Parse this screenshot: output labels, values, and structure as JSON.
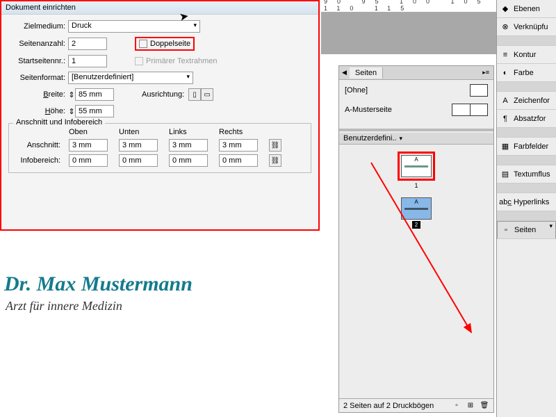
{
  "dialog": {
    "title": "Dokument einrichten",
    "zielmedium_lbl": "Zielmedium:",
    "zielmedium_val": "Druck",
    "seitenanzahl_lbl": "Seitenanzahl:",
    "seitenanzahl_val": "2",
    "doppelseite_lbl": "Doppelseite",
    "startseite_lbl": "Startseitennr.:",
    "startseite_val": "1",
    "textrahmen_lbl": "Primärer Textrahmen",
    "seitenformat_lbl": "Seitenformat:",
    "seitenformat_val": "[Benutzerdefiniert]",
    "breite_lbl": "Breite:",
    "breite_val": "85 mm",
    "hoehe_lbl": "Höhe:",
    "hoehe_val": "55 mm",
    "ausrichtung_lbl": "Ausrichtung:",
    "group_title": "Anschnitt und Infobereich",
    "col_oben": "Oben",
    "col_unten": "Unten",
    "col_links": "Links",
    "col_rechts": "Rechts",
    "anschnitt_lbl": "Anschnitt:",
    "anschnitt_vals": [
      "3 mm",
      "3 mm",
      "3 mm",
      "3 mm"
    ],
    "info_lbl": "Infobereich:",
    "info_vals": [
      "0 mm",
      "0 mm",
      "0 mm",
      "0 mm"
    ]
  },
  "ruler_marks": "90 95 100 105 110 115",
  "right_panel": [
    {
      "icon": "◆",
      "label": "Ebenen"
    },
    {
      "icon": "⊗",
      "label": "Verknüpfu"
    },
    {
      "space": true
    },
    {
      "icon": "≡",
      "label": "Kontur"
    },
    {
      "icon": "◐",
      "label": "Farbe"
    },
    {
      "space": true
    },
    {
      "icon": "A",
      "label": "Zeichenfor"
    },
    {
      "icon": "¶",
      "label": "Absatzfor"
    },
    {
      "space": true
    },
    {
      "icon": "▦",
      "label": "Farbfelder"
    },
    {
      "space": true
    },
    {
      "icon": "▤",
      "label": "Textumflus"
    },
    {
      "space": true
    },
    {
      "icon": "abc̲",
      "label": "Hyperlinks"
    },
    {
      "space": true
    },
    {
      "icon": "▫",
      "label": "Seiten",
      "sel": true
    }
  ],
  "seiten_panel": {
    "tab": "Seiten",
    "ohne": "[Ohne]",
    "muster": "A-Musterseite",
    "dropdown": "Benutzerdefini..",
    "page_letter": "A",
    "page2_num": "2",
    "footer": "2 Seiten auf 2 Druckbögen"
  },
  "document": {
    "name": "Dr. Max Mustermann",
    "subtitle": "Arzt für innere Medizin"
  }
}
